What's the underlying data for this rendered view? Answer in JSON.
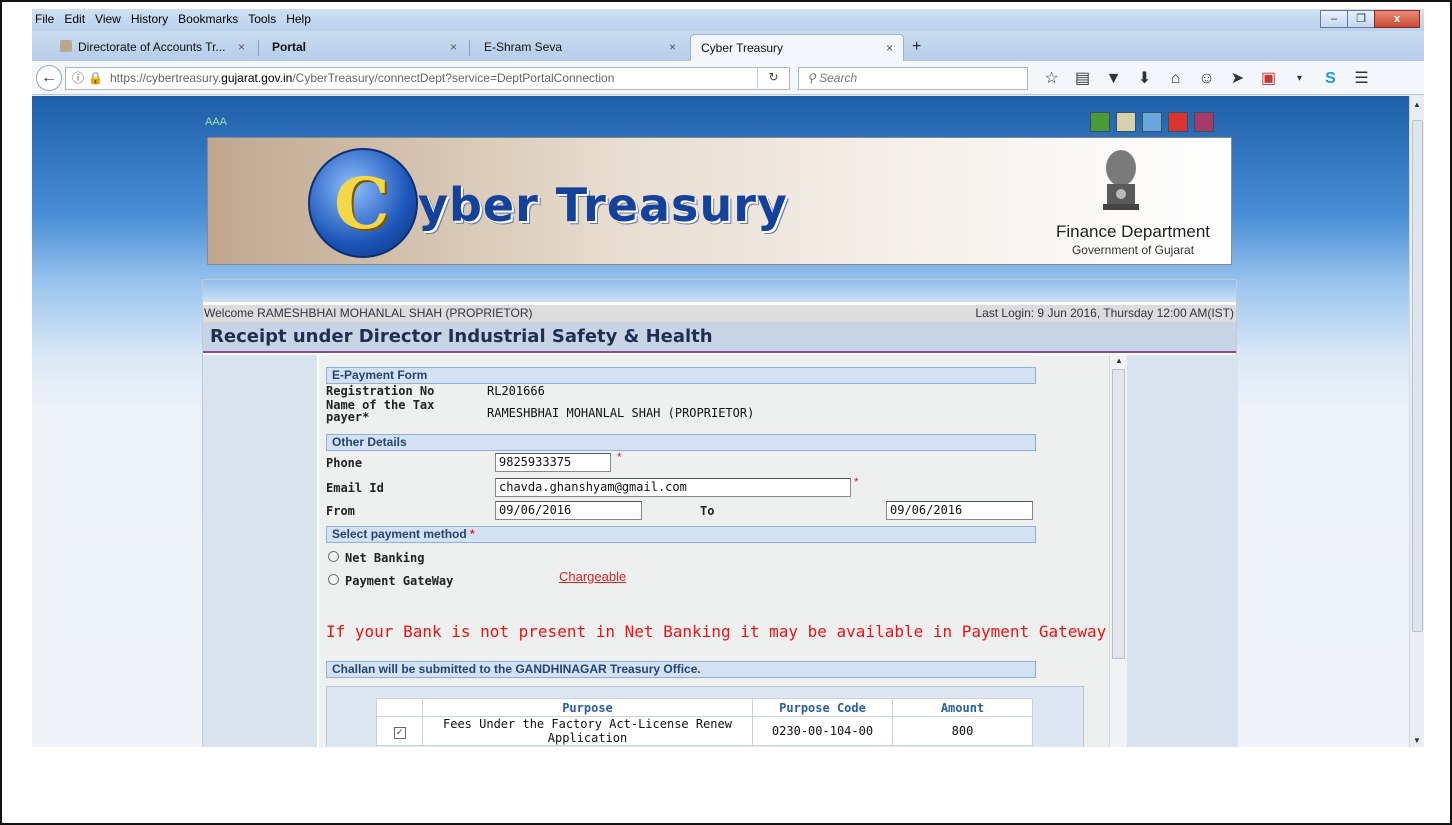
{
  "menubar": {
    "items": [
      "File",
      "Edit",
      "View",
      "History",
      "Bookmarks",
      "Tools",
      "Help"
    ],
    "window_controls": [
      "minimize",
      "restore",
      "close"
    ]
  },
  "tabs": [
    {
      "label": "Directorate of Accounts Tr...",
      "close": "×",
      "active": false
    },
    {
      "label": "Portal",
      "close": "×",
      "active": false
    },
    {
      "label": "E-Shram Seva",
      "close": "×",
      "active": false
    },
    {
      "label": "Cyber Treasury",
      "close": "×",
      "active": true
    }
  ],
  "newtab": "+",
  "nav": {
    "url_prefix": "https://cybertreasury.",
    "url_domain": "gujarat.gov.in",
    "url_suffix": "/CyberTreasury/connectDept?service=DeptPortalConnection",
    "search_placeholder": "Search",
    "back_icon": "arrow-left-icon",
    "tool_icons": [
      "star-icon",
      "reading-list-icon",
      "pocket-icon",
      "download-icon",
      "home-icon",
      "chat-icon",
      "send-icon",
      "addon-icon",
      "dropdown-icon",
      "skype-icon",
      "menu-icon"
    ]
  },
  "page": {
    "fontsize_control": "AAA",
    "banner": {
      "logo_letter": "C",
      "logo_text": "yber Treasury",
      "dept": "Finance Department",
      "gov": "Government of Gujarat"
    },
    "welcome_text": "Welcome RAMESHBHAI MOHANLAL SHAH (PROPRIETOR)",
    "last_login": "Last Login: 9 Jun 2016, Thursday 12:00 AM(IST)",
    "title": "Receipt under Director Industrial Safety & Health"
  },
  "form": {
    "section_epayment": "E-Payment Form",
    "reg_label": "Registration No",
    "reg_value": "RL201666",
    "name_label": "Name of the Tax payer*",
    "name_value": "RAMESHBHAI MOHANLAL SHAH (PROPRIETOR)",
    "section_other": "Other Details",
    "phone_label": "Phone",
    "phone_value": "9825933375",
    "email_label": "Email Id",
    "email_value": "chavda.ghanshyam@gmail.com",
    "from_label": "From",
    "from_value": "09/06/2016",
    "to_label": "To",
    "to_value": "09/06/2016",
    "required_mark": "*",
    "section_payment": "Select payment method",
    "netbanking_label": "Net Banking",
    "gateway_label": "Payment GateWay",
    "chargeable_label": "Chargeable",
    "note": "If your Bank is not present in Net Banking it may be available in Payment Gateway",
    "section_challan": "Challan will be submitted to the GANDHINAGAR Treasury Office."
  },
  "table": {
    "headers": [
      "",
      "Purpose",
      "Purpose Code",
      "Amount"
    ],
    "rows": [
      {
        "checked": "✓",
        "purpose": "Fees Under the Factory Act-License Renew Application",
        "code": "0230-00-104-00",
        "amount": "800"
      }
    ]
  }
}
